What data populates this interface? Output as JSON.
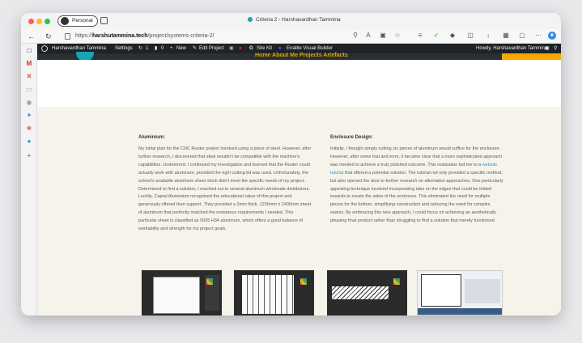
{
  "browser": {
    "profile_label": "Personal",
    "tab_title": "Criteria 2 - Harshavardhan Tammina",
    "url_prefix": "https://",
    "url_host": "harshutammina.tech",
    "url_path": "/project/systems-criteria-2/"
  },
  "wp_admin_bar": {
    "site_name": "Harshavardhan Tammina",
    "settings": "Settings",
    "updates_count": "1",
    "comments_count": "0",
    "new_label": "New",
    "edit_project": "Edit Project",
    "site_kit": "Site Kit",
    "visual_builder": "Enable Visual Builder",
    "howdy": "Howdy, Harshavardhan Tammina"
  },
  "site_nav": {
    "items_text": "Home   About Me   Projects   Artefacts"
  },
  "content": {
    "aluminium": {
      "heading": "Aluminium:",
      "body": "My initial plan for the CNC Router project involved using a piece of steel. However, after further research, I discovered that steel wouldn't be compatible with the machine's capabilities. Undeterred, I continued my investigation and learned that the Router could actually work with aluminum, provided the right cutting bit was used. Unfortunately, the school's available aluminum sheet stock didn't meet the specific needs of my project. Determined to find a solution, I reached out to several aluminum wholesale distributors. Luckily, Capral Aluminium recognized the educational value of this project and generously offered their support. They provided a 2mm thick, 1200mm x 2400mm sheet of aluminum that perfectly matched the resistance requirements I needed. This particular sheet is classified as 5005 H34 aluminum, which offers a good balance of workability and strength for my project goals."
    },
    "enclosure": {
      "heading": "Enclosure Design:",
      "body_before_link": "Initially, I thought simply cutting six pieces of aluminum would suffice for the enclosure. However, after some trial and error, it became clear that a more sophisticated approach was needed to achieve a truly polished outcome. This realization led me to a ",
      "link_text": "website tutorial",
      "body_after_link": " that offered a potential solution. The tutorial not only provided a specific method, but also opened the door to further research on alternative approaches. One particularly appealing technique involved incorporating tabs on the edges that could be folded inwards to create the sides of the enclosure. This eliminated the need for multiple pieces for the bottom, simplifying construction and reducing the need for complex seams. By embracing this new approach, I could focus on achieving an aesthetically pleasing final product rather than struggling to find a solution that merely functioned."
    }
  },
  "colors": {
    "accent_teal": "#16a3b5",
    "nav_gold": "#e0a800",
    "cta_orange": "#f5a800",
    "link_blue": "#1e9bd7",
    "page_bg": "#f6f3ea",
    "admin_bar": "#1d2327"
  },
  "icons": [
    "back-icon",
    "refresh-icon",
    "lock-icon",
    "zoom-icon",
    "read-aloud-icon",
    "favorites-icon",
    "collections-icon",
    "extensions-icon",
    "copilot-icon"
  ]
}
